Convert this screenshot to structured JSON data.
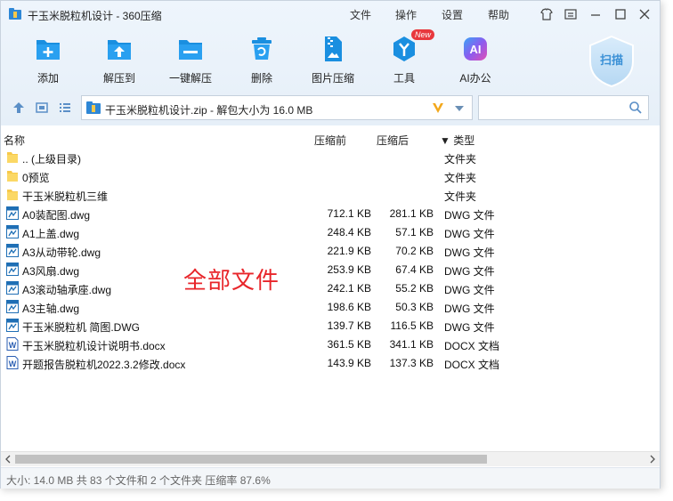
{
  "window": {
    "title": "干玉米脱粒机设计 - 360压缩"
  },
  "menu": [
    "文件",
    "操作",
    "设置",
    "帮助"
  ],
  "toolbar": [
    {
      "label": "添加",
      "icon": "add-icon"
    },
    {
      "label": "解压到",
      "icon": "extract-to-icon"
    },
    {
      "label": "一键解压",
      "icon": "one-click-extract-icon"
    },
    {
      "label": "删除",
      "icon": "delete-icon"
    },
    {
      "label": "图片压缩",
      "icon": "image-compress-icon"
    },
    {
      "label": "工具",
      "icon": "tools-icon",
      "badge": "New"
    },
    {
      "label": "AI办公",
      "icon": "ai-office-icon",
      "icon_text": "AI"
    }
  ],
  "scan": {
    "label": "扫描"
  },
  "address": {
    "path": "干玉米脱粒机设计.zip - 解包大小为 16.0 MB",
    "search_placeholder": ""
  },
  "columns": {
    "name": "名称",
    "size": "压缩前",
    "compressed": "压缩后",
    "type": "▼ 类型"
  },
  "files": [
    {
      "name": ".. (上级目录)",
      "size": "",
      "compressed": "",
      "type": "文件夹",
      "kind": "folder"
    },
    {
      "name": "0预览",
      "size": "",
      "compressed": "",
      "type": "文件夹",
      "kind": "folder"
    },
    {
      "name": "干玉米脱粒机三维",
      "size": "",
      "compressed": "",
      "type": "文件夹",
      "kind": "folder"
    },
    {
      "name": "A0装配图.dwg",
      "size": "712.1 KB",
      "compressed": "281.1 KB",
      "type": "DWG 文件",
      "kind": "dwg"
    },
    {
      "name": "A1上盖.dwg",
      "size": "248.4 KB",
      "compressed": "57.1 KB",
      "type": "DWG 文件",
      "kind": "dwg"
    },
    {
      "name": "A3从动带轮.dwg",
      "size": "221.9 KB",
      "compressed": "70.2 KB",
      "type": "DWG 文件",
      "kind": "dwg"
    },
    {
      "name": "A3风扇.dwg",
      "size": "253.9 KB",
      "compressed": "67.4 KB",
      "type": "DWG 文件",
      "kind": "dwg"
    },
    {
      "name": "A3滚动轴承座.dwg",
      "size": "242.1 KB",
      "compressed": "55.2 KB",
      "type": "DWG 文件",
      "kind": "dwg"
    },
    {
      "name": "A3主轴.dwg",
      "size": "198.6 KB",
      "compressed": "50.3 KB",
      "type": "DWG 文件",
      "kind": "dwg"
    },
    {
      "name": "干玉米脱粒机 简图.DWG",
      "size": "139.7 KB",
      "compressed": "116.5 KB",
      "type": "DWG 文件",
      "kind": "dwg"
    },
    {
      "name": "干玉米脱粒机设计说明书.docx",
      "size": "361.5 KB",
      "compressed": "341.1 KB",
      "type": "DOCX 文档",
      "kind": "docx"
    },
    {
      "name": "开题报告脱粒机2022.3.2修改.docx",
      "size": "143.9 KB",
      "compressed": "137.3 KB",
      "type": "DOCX 文档",
      "kind": "docx"
    }
  ],
  "watermark": "全部文件",
  "status": "大小: 14.0 MB 共 83 个文件和 2 个文件夹 压缩率 87.6%",
  "colors": {
    "accent": "#1a8fe0",
    "watermark": "#e8252a",
    "folder": "#f7c94b"
  }
}
